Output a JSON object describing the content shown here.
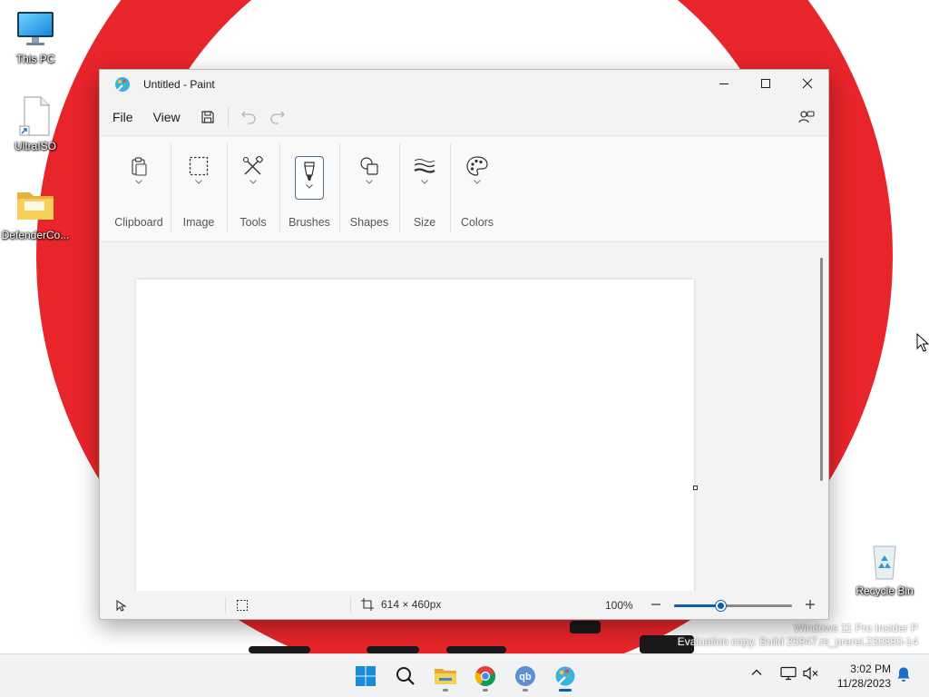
{
  "desktop": {
    "icons": [
      {
        "label": "This PC"
      },
      {
        "label": "UltraISO"
      },
      {
        "label": "DefenderCo..."
      }
    ],
    "recycle_bin": {
      "label": "Recycle Bin"
    },
    "watermark": {
      "line1": "Windows 11 Pro Insider P",
      "line2": "Evaluation copy. Build 25947.rs_prerel.230890-14"
    },
    "wallpaper_color": "#e8252b"
  },
  "paint": {
    "title": "Untitled - Paint",
    "menu": {
      "file": "File",
      "view": "View"
    },
    "ribbon": {
      "groups": [
        {
          "label": "Clipboard",
          "icon": "clipboard-icon"
        },
        {
          "label": "Image",
          "icon": "selection-icon"
        },
        {
          "label": "Tools",
          "icon": "tools-icon"
        },
        {
          "label": "Brushes",
          "icon": "brush-icon"
        },
        {
          "label": "Shapes",
          "icon": "shapes-icon"
        },
        {
          "label": "Size",
          "icon": "size-icon"
        },
        {
          "label": "Colors",
          "icon": "palette-icon"
        }
      ],
      "selected_group": "Brushes"
    },
    "status": {
      "canvas_size": "614 × 460px",
      "zoom": "100%",
      "zoom_fraction": 0.4
    },
    "accent_color": "#0a5fb4"
  },
  "taskbar": {
    "apps": [
      "start-icon",
      "search-icon",
      "file-explorer-icon",
      "chrome-icon",
      "qbittorrent-icon",
      "paint-icon"
    ],
    "time": "3:02 PM",
    "date": "11/28/2023"
  }
}
